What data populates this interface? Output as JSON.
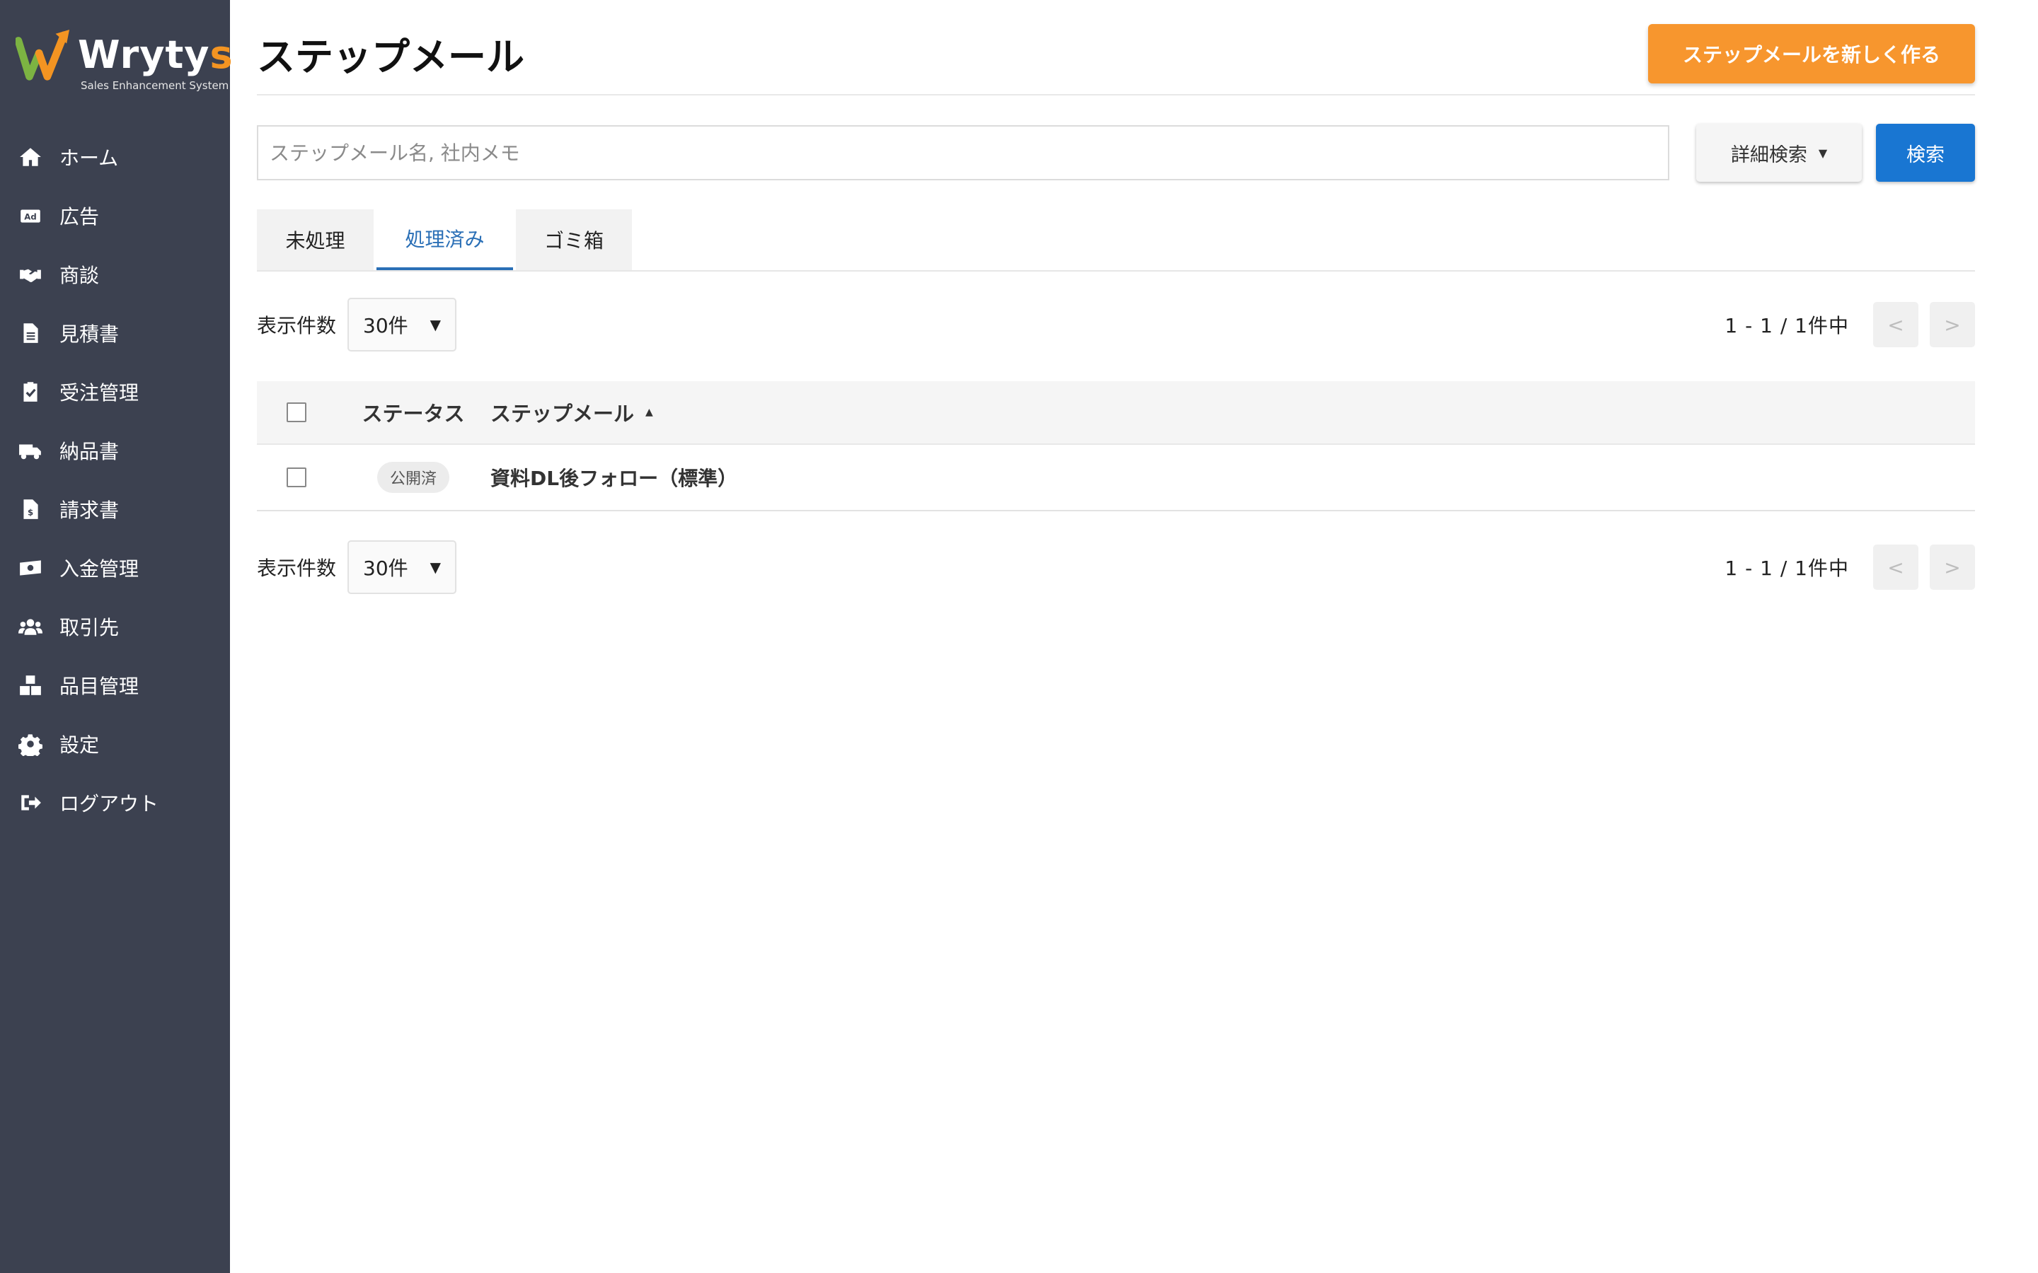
{
  "brand": {
    "name_main": "Wryty",
    "name_accent": "s",
    "tagline": "Sales Enhancement System",
    "colors": {
      "accent": "#f39422",
      "green": "#7cb342",
      "sidebar": "#3c4150"
    }
  },
  "sidebar": {
    "items": [
      {
        "label": "ホーム",
        "icon": "home-icon"
      },
      {
        "label": "広告",
        "icon": "ad-icon"
      },
      {
        "label": "商談",
        "icon": "handshake-icon"
      },
      {
        "label": "見積書",
        "icon": "document-icon"
      },
      {
        "label": "受注管理",
        "icon": "clipboard-check-icon"
      },
      {
        "label": "納品書",
        "icon": "truck-icon"
      },
      {
        "label": "請求書",
        "icon": "invoice-icon"
      },
      {
        "label": "入金管理",
        "icon": "money-icon"
      },
      {
        "label": "取引先",
        "icon": "users-icon"
      },
      {
        "label": "品目管理",
        "icon": "boxes-icon"
      },
      {
        "label": "設定",
        "icon": "gear-icon"
      },
      {
        "label": "ログアウト",
        "icon": "logout-icon"
      }
    ]
  },
  "header": {
    "title": "ステップメール",
    "new_button": "ステップメールを新しく作る"
  },
  "search": {
    "placeholder": "ステップメール名, 社内メモ",
    "value": "",
    "detail_button": "詳細検索",
    "search_button": "検索"
  },
  "tabs": [
    {
      "label": "未処理",
      "active": false
    },
    {
      "label": "処理済み",
      "active": true
    },
    {
      "label": "ゴミ箱",
      "active": false
    }
  ],
  "list_controls": {
    "per_page_label": "表示件数",
    "per_page_value": "30件",
    "pager_text": "1 - 1 / 1件中",
    "prev": "<",
    "next": ">"
  },
  "table": {
    "columns": {
      "status": "ステータス",
      "name": "ステップメール"
    },
    "rows": [
      {
        "status": "公開済",
        "name": "資料DL後フォロー（標準）"
      }
    ]
  }
}
